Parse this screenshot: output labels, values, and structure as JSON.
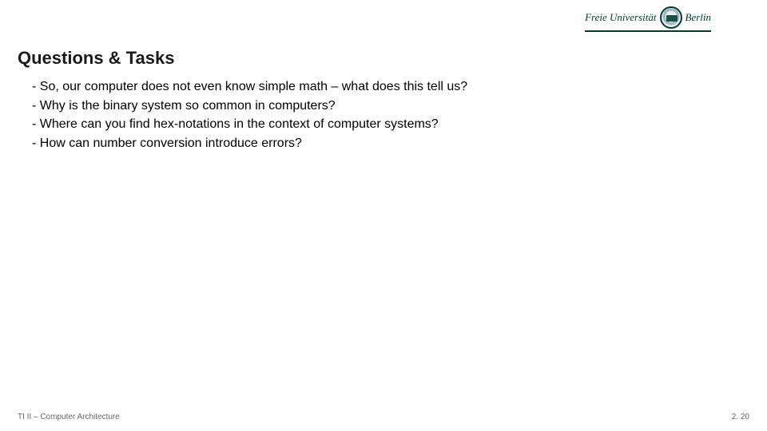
{
  "header": {
    "logo_left": "Freie Universität",
    "logo_right": "Berlin"
  },
  "title": "Questions & Tasks",
  "bullets": [
    "- So, our computer does not even know simple math – what does this tell us?",
    "- Why is the binary system so common in computers?",
    "- Where can you find hex-notations in the context of computer systems?",
    "- How can number conversion introduce errors?"
  ],
  "footer": {
    "left": "TI II – Computer Architecture",
    "right": "2. 20"
  }
}
